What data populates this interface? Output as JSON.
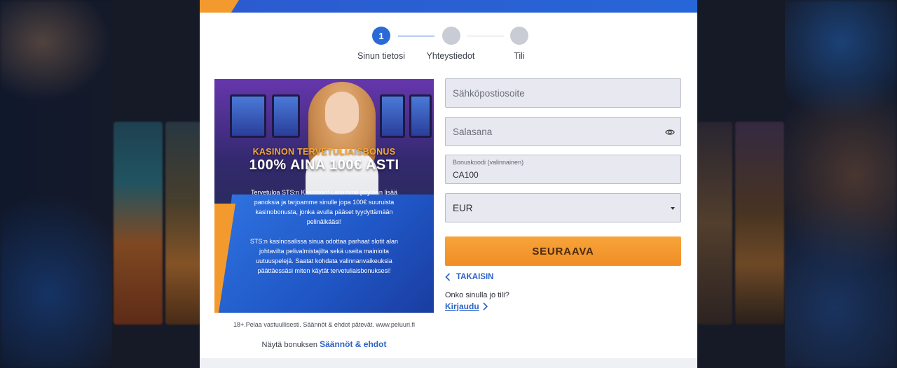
{
  "stepper": {
    "steps": [
      {
        "number": "1",
        "label": "Sinun tietosi",
        "active": true
      },
      {
        "number": "",
        "label": "Yhteystiedot",
        "active": false
      },
      {
        "number": "",
        "label": "Tili",
        "active": false
      }
    ]
  },
  "promo": {
    "subtitle": "KASINON TERVETULIAISBONUS",
    "title": "100% AINA 100€ ASTI",
    "paragraph1": "Tervetuloa STS:n Kasinoon! Laitamme pöytään lisää panoksia ja tarjoamme sinulle jopa 100€ suuruista kasinobonusta, jonka avulla pääset tyydyttämään pelinälkääsi!",
    "paragraph2": "STS:n kasinosalissa sinua odottaa parhaat slotit alan johtavilta pelivalmistajilta sekä useita mainioita uutuuspelejä. Saatat kohdata valinnanvaikeuksia päättäessäsi miten käytät tervetuliaisbonuksesi!"
  },
  "legal": "18+.Pelaa vastuullisesti. Säännöt & ehdot pätevät. www.peluuri.fi",
  "terms": {
    "prefix": "Näytä bonuksen",
    "link": "Säännöt & ehdot"
  },
  "form": {
    "email_placeholder": "Sähköpostiosoite",
    "password_placeholder": "Salasana",
    "bonus_label": "Bonuskoodi (valinnainen)",
    "bonus_value": "CA100",
    "currency_value": "EUR",
    "next_label": "SEURAAVA",
    "back_label": "TAKAISIN",
    "account_question": "Onko sinulla jo tili?",
    "login_label": "Kirjaudu"
  },
  "colors": {
    "accent_blue": "#2b6ad6",
    "accent_orange": "#f39a2e"
  }
}
